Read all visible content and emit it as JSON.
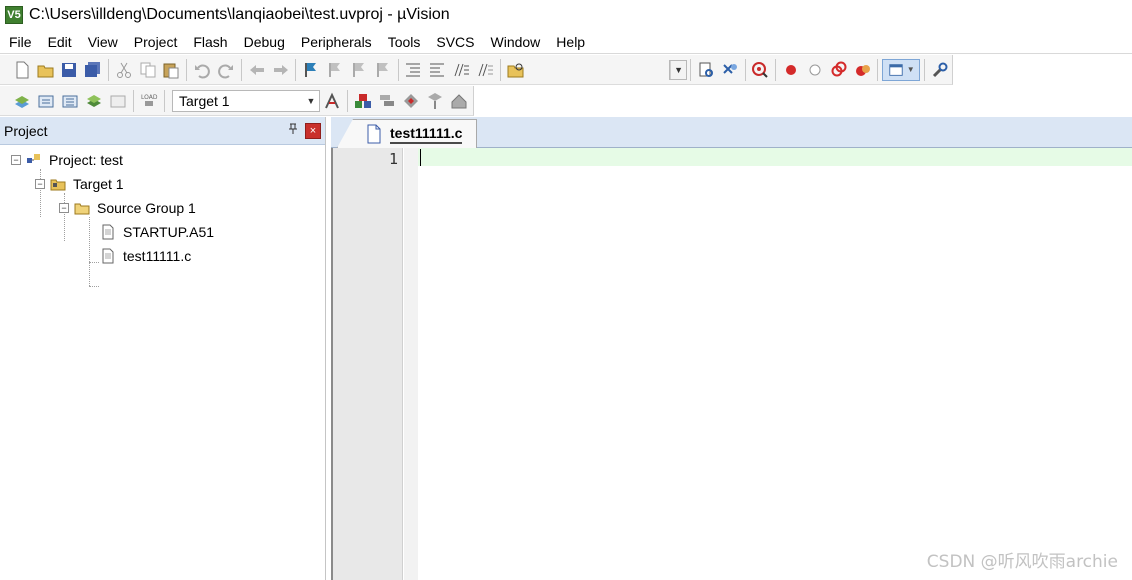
{
  "window": {
    "title": "C:\\Users\\illdeng\\Documents\\lanqiaobei\\test.uvproj - µVision",
    "app_icon_text": "V5",
    "app_icon_name": "uvision-logo-icon"
  },
  "menu": {
    "items": [
      "File",
      "Edit",
      "View",
      "Project",
      "Flash",
      "Debug",
      "Peripherals",
      "Tools",
      "SVCS",
      "Window",
      "Help"
    ]
  },
  "toolbar": {
    "target_select": "Target 1",
    "icons_row1": [
      "new-file-icon",
      "open-file-icon",
      "save-icon",
      "save-all-icon",
      "cut-icon",
      "copy-icon",
      "paste-icon",
      "undo-icon",
      "redo-icon",
      "nav-back-icon",
      "nav-forward-icon",
      "bookmark-icon",
      "prev-bookmark-icon",
      "next-bookmark-icon",
      "clear-bookmarks-icon",
      "indent-icon",
      "unindent-icon",
      "comment-icon",
      "uncomment-icon",
      "find-in-files-icon",
      "find-dropdown",
      "find-icon",
      "incremental-find-icon",
      "debug-session-icon",
      "breakpoint-icon",
      "disable-breakpoint-icon",
      "kill-breakpoints-icon",
      "kill-all-breakpoints-icon",
      "window-layout-icon",
      "configure-icon"
    ],
    "icons_row2": [
      "translate-icon",
      "build-icon",
      "rebuild-icon",
      "batch-build-icon",
      "stop-build-icon",
      "download-icon",
      "target-options-icon",
      "manage-project-icon",
      "select-packs-icon",
      "manage-rte-icon",
      "pack-installer-icon",
      "event-recorder-icon"
    ]
  },
  "project_panel": {
    "title": "Project",
    "pin_glyph": "ꟷ",
    "close_glyph": "×",
    "tree": {
      "root": "Project: test",
      "target": "Target 1",
      "group": "Source Group 1",
      "files": [
        "STARTUP.A51",
        "test11111.c"
      ]
    }
  },
  "editor": {
    "tab_label": "test11111.c",
    "line_numbers": [
      "1"
    ],
    "content": "",
    "current_line_color": "#e6fbe6"
  },
  "watermark": "CSDN @听风吹雨archie",
  "colors": {
    "panel_header": "#dbe6f4",
    "close_button": "#c9302c",
    "app_icon": "#3f7f2f"
  }
}
